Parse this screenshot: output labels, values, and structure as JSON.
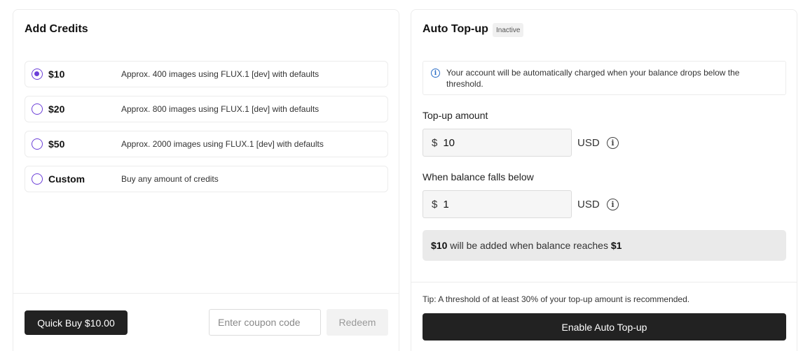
{
  "add_credits": {
    "title": "Add Credits",
    "options": [
      {
        "amount": "$10",
        "description": "Approx. 400 images using FLUX.1 [dev] with defaults",
        "selected": true
      },
      {
        "amount": "$20",
        "description": "Approx. 800 images using FLUX.1 [dev] with defaults",
        "selected": false
      },
      {
        "amount": "$50",
        "description": "Approx. 2000 images using FLUX.1 [dev] with defaults",
        "selected": false
      },
      {
        "amount": "Custom",
        "description": "Buy any amount of credits",
        "selected": false
      }
    ],
    "quick_buy_label": "Quick Buy $10.00",
    "coupon_placeholder": "Enter coupon code",
    "redeem_label": "Redeem"
  },
  "auto_topup": {
    "title": "Auto Top-up",
    "status_badge": "Inactive",
    "info_text": "Your account will be automatically charged when your balance drops below the threshold.",
    "topup_label": "Top-up amount",
    "topup_currency_symbol": "$",
    "topup_value": "10",
    "topup_unit": "USD",
    "threshold_label": "When balance falls below",
    "threshold_currency_symbol": "$",
    "threshold_value": "1",
    "threshold_unit": "USD",
    "summary": {
      "amount": "$10",
      "middle": " will be added when balance reaches ",
      "threshold": "$1"
    },
    "tip_text": "Tip: A threshold of at least 30% of your top-up amount is recommended.",
    "enable_label": "Enable Auto Top-up"
  },
  "colors": {
    "accent": "#6b3fd8",
    "dark_button": "#222222",
    "info_blue": "#2b6ec7"
  }
}
